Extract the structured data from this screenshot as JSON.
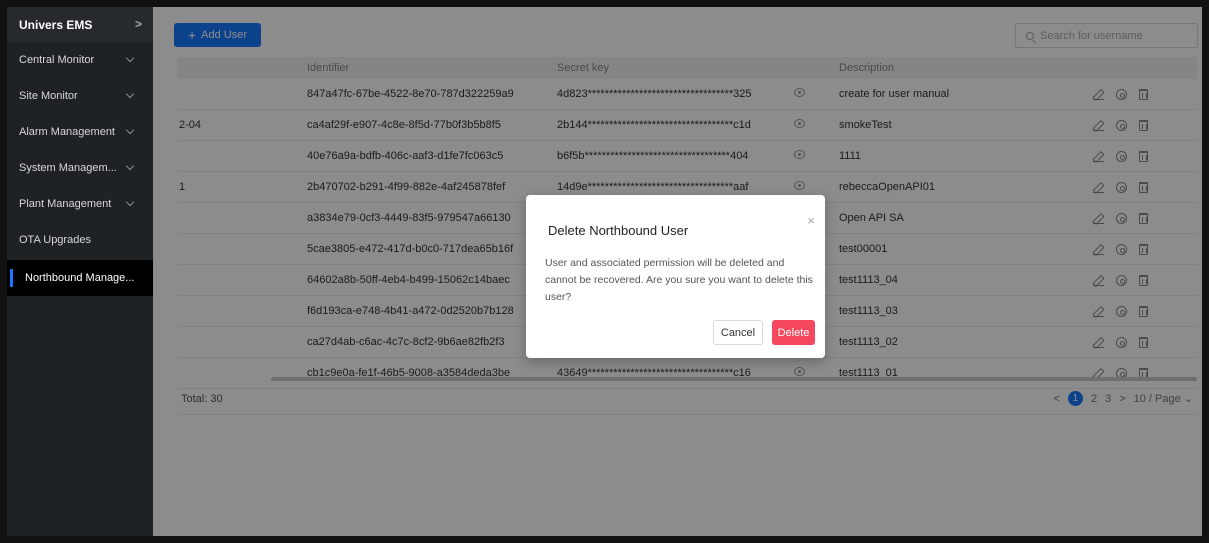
{
  "sidebar": {
    "title": "Univers EMS",
    "items": [
      {
        "label": "Central Monitor"
      },
      {
        "label": "Site Monitor"
      },
      {
        "label": "Alarm Management"
      },
      {
        "label": "System Managem..."
      },
      {
        "label": "Plant Management"
      },
      {
        "label": "OTA Upgrades"
      },
      {
        "label": "Northbound Manage..."
      }
    ]
  },
  "toolbar": {
    "add_label": "Add User",
    "search_placeholder": "Search for username"
  },
  "table": {
    "headers": {
      "identifier": "Identifier",
      "secret": "Secret key",
      "description": "Description"
    },
    "rows": [
      {
        "a": "",
        "identifier": "847a47fc-67be-4522-8e70-787d322259a9",
        "secret": "4d823**********************************325",
        "description": "create for user manual"
      },
      {
        "a": "2-04",
        "identifier": "ca4af29f-e907-4c8e-8f5d-77b0f3b5b8f5",
        "secret": "2b144**********************************c1d",
        "description": "smokeTest"
      },
      {
        "a": "",
        "identifier": "40e76a9a-bdfb-406c-aaf3-d1fe7fc063c5",
        "secret": "b6f5b**********************************404",
        "description": "1111"
      },
      {
        "a": "1",
        "identifier": "2b470702-b291-4f99-882e-4af245878fef",
        "secret": "14d9e**********************************aaf",
        "description": "rebeccaOpenAPI01"
      },
      {
        "a": "",
        "identifier": "a3834e79-0cf3-4449-83f5-979547a66130",
        "secret": "",
        "description": "Open API SA"
      },
      {
        "a": "",
        "identifier": "5cae3805-e472-417d-b0c0-717dea65b16f",
        "secret": "",
        "description": "test00001"
      },
      {
        "a": "",
        "identifier": "64602a8b-50ff-4eb4-b499-15062c14baec",
        "secret": "",
        "description": "test1113_04"
      },
      {
        "a": "",
        "identifier": "f6d193ca-e748-4b41-a472-0d2520b7b128",
        "secret": "",
        "description": "test1113_03"
      },
      {
        "a": "",
        "identifier": "ca27d4ab-c6ac-4c7c-8cf2-9b6ae82fb2f3",
        "secret": "",
        "description": "test1113_02"
      },
      {
        "a": "",
        "identifier": "cb1c9e0a-fe1f-46b5-9008-a3584deda3be",
        "secret": "43649**********************************c16",
        "description": "test1113_01"
      }
    ]
  },
  "footer": {
    "total": "Total: 30",
    "pages": [
      "1",
      "2",
      "3"
    ],
    "page_size": "10 / Page"
  },
  "modal": {
    "title": "Delete Northbound User",
    "body": "User and associated permission will be deleted and cannot be recovered. Are you sure you want to delete this user?",
    "cancel": "Cancel",
    "delete": "Delete"
  },
  "colors": {
    "accent": "#1677ff",
    "danger": "#f5485f",
    "sidebar": "#1f2224"
  }
}
